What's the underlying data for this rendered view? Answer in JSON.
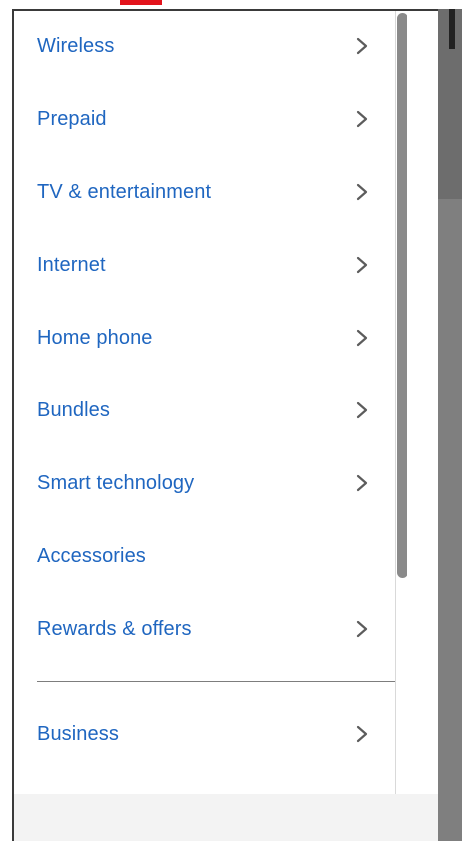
{
  "menu": {
    "items": [
      {
        "label": "Wireless",
        "has_chevron": true
      },
      {
        "label": "Prepaid",
        "has_chevron": true
      },
      {
        "label": "TV & entertainment",
        "has_chevron": true
      },
      {
        "label": "Internet",
        "has_chevron": true
      },
      {
        "label": "Home phone",
        "has_chevron": true
      },
      {
        "label": "Bundles",
        "has_chevron": true
      },
      {
        "label": "Smart technology",
        "has_chevron": true
      },
      {
        "label": "Accessories",
        "has_chevron": false
      },
      {
        "label": "Rewards & offers",
        "has_chevron": true
      }
    ],
    "secondary_items": [
      {
        "label": "Business",
        "has_chevron": true
      }
    ]
  },
  "icons": {
    "chevron": "chevron-right-icon"
  },
  "colors": {
    "link_blue": "#1f66c0",
    "chevron_gray": "#5c5c5c",
    "accent_red": "#e3141c"
  }
}
